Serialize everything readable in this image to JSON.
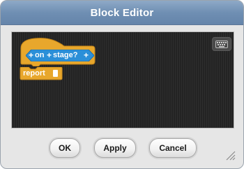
{
  "window": {
    "title": "Block Editor"
  },
  "script": {
    "hat_block": {
      "predicate": {
        "word1": "on",
        "word2": "stage?",
        "left_arrow": "+",
        "plus": "+",
        "right_arrow": "+"
      }
    },
    "report_block": {
      "label": "report"
    }
  },
  "buttons": {
    "ok": "OK",
    "apply": "Apply",
    "cancel": "Cancel"
  },
  "colors": {
    "titlebar": "#6f8fb3",
    "hat_block": "#e8a72c",
    "predicate": "#2b8fd8",
    "script_bg": "#262626"
  },
  "icons": {
    "keyboard": "keyboard-icon",
    "resize": "resize-grip-icon"
  }
}
